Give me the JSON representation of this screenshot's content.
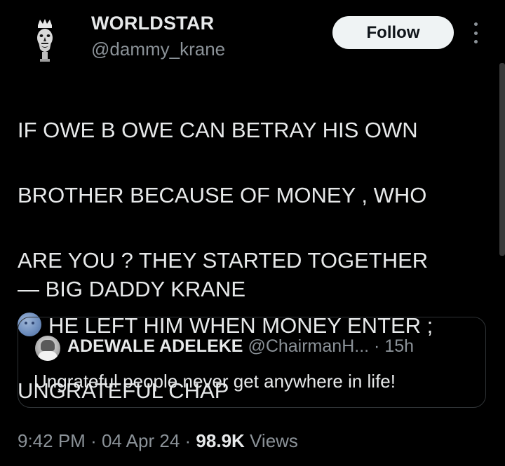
{
  "author": {
    "display_name": "WORLDSTAR",
    "handle": "@dammy_krane",
    "avatar_icon": "crowned-head-avatar-icon"
  },
  "actions": {
    "follow_label": "Follow",
    "more_icon": "more-vertical-icon"
  },
  "tweet": {
    "lines": [
      "IF OWE B OWE CAN BETRAY HIS OWN",
      "BROTHER BECAUSE OF MONEY , WHO",
      "ARE YOU ? THEY STARTED TOGETHER",
      "HE LEFT HIM WHEN MONEY ENTER ;",
      "UNGRATEFUL CHAP"
    ],
    "emoji_icon": "new-moon-face-emoji",
    "signature": "— BIG DADDY KRANE"
  },
  "quoted": {
    "name": "ADEWALE ADELEKE",
    "handle": "@ChairmanH...",
    "separator": "·",
    "time": "15h",
    "text": "Ungrateful people never get anywhere in life!"
  },
  "meta": {
    "time": "9:42 PM",
    "sep1": "·",
    "date": "04 Apr 24",
    "sep2": "·",
    "views_count": "98.9K",
    "views_label": "Views"
  },
  "colors": {
    "background": "#000000",
    "text_primary": "#e7e9ea",
    "text_secondary": "#8b9298",
    "follow_bg": "#eff3f4",
    "border": "#2f3336"
  }
}
